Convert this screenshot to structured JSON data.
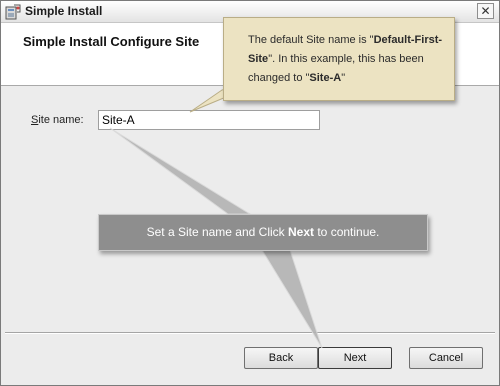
{
  "window": {
    "title": "Simple Install",
    "close_glyph": "✕"
  },
  "header": {
    "title": "Simple Install Configure Site"
  },
  "form": {
    "site_label_accel": "S",
    "site_label_rest": "ite name:",
    "site_value": "Site-A"
  },
  "buttons": {
    "back": "Back",
    "next": "Next",
    "cancel": "Cancel"
  },
  "callouts": {
    "top": {
      "t1": "The default Site name is \"",
      "b1": "Default-First-Site",
      "t2": "\". In this example, this has been changed to \"",
      "b2": "Site-A",
      "t3": "\""
    },
    "middle": {
      "t1": "Set a Site name and Click ",
      "b1": "Next",
      "t2": " to continue."
    }
  },
  "colors": {
    "callout_top_bg": "#ece3c2",
    "callout_mid_bg": "#8e8e8e",
    "dialog_bg": "#ececec"
  },
  "icons": [
    "installer-icon",
    "close-icon"
  ]
}
